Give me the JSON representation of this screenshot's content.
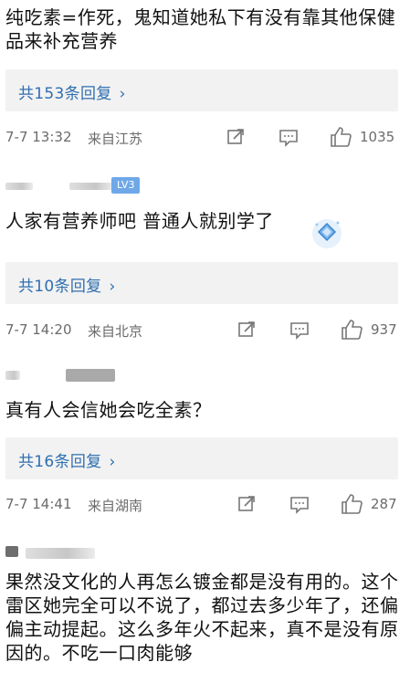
{
  "comments": [
    {
      "text": "纯吃素=作死，鬼知道她私下有没有靠其他保健品来补充营养",
      "reply_label": "共153条回复",
      "time": "7-7 13:32",
      "location": "来自江苏",
      "likes": "1035"
    },
    {
      "level": "LV3",
      "text": "人家有营养师吧 普通人就别学了",
      "reply_label": "共10条回复",
      "time": "7-7 14:20",
      "location": "来自北京",
      "likes": "937"
    },
    {
      "text": "真有人会信她会吃全素？",
      "reply_label": "共16条回复",
      "time": "7-7 14:41",
      "location": "来自湖南",
      "likes": "287"
    },
    {
      "text": "果然没文化的人再怎么镀金都是没有用的。这个雷区她完全可以不说了，都过去多少年了，还偏偏主动提起。这么多年火不起来，真不是没有原因的。不吃一口肉能够"
    }
  ],
  "reply_chevron": "›",
  "icons": {
    "share": "share-icon",
    "comment": "comment-icon",
    "like": "thumbs-up-icon"
  },
  "colors": {
    "link": "#2f6fb0",
    "reply_bg": "#f2f2f2",
    "meta": "#6b6b6b"
  }
}
